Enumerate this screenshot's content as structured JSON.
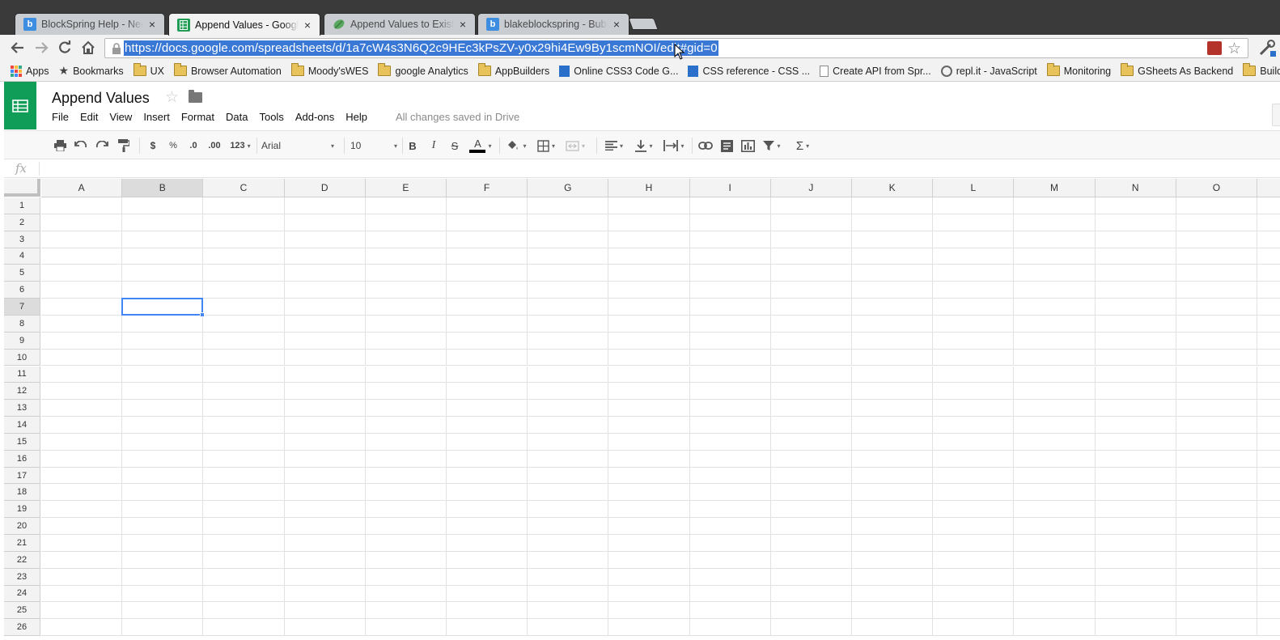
{
  "browser": {
    "tabs": [
      {
        "title": "BlockSpring Help - Need h",
        "favicon": "blockspring-icon",
        "active": false
      },
      {
        "title": "Append Values - Google S",
        "favicon": "google-sheets-icon",
        "active": true
      },
      {
        "title": "Append Values to Existing",
        "favicon": "leaf-icon",
        "active": false
      },
      {
        "title": "blakeblockspring - Bubble",
        "favicon": "blockspring-icon",
        "active": false
      }
    ],
    "close_glyph": "×",
    "url": "https://docs.google.com/spreadsheets/d/1a7cW4s3N6Q2c9HEc3kPsZV-y0x29hi4Ew9By1scmNOI/edit#gid=0",
    "bookmarks": [
      {
        "label": "Apps",
        "icon": "apps-grid-icon"
      },
      {
        "label": "Bookmarks",
        "icon": "star-icon"
      },
      {
        "label": "UX",
        "icon": "folder-icon"
      },
      {
        "label": "Browser Automation",
        "icon": "folder-icon"
      },
      {
        "label": "Moody'sWES",
        "icon": "folder-icon"
      },
      {
        "label": "google Analytics",
        "icon": "folder-icon"
      },
      {
        "label": "AppBuilders",
        "icon": "folder-icon"
      },
      {
        "label": "Online CSS3 Code G...",
        "icon": "css3-icon"
      },
      {
        "label": "CSS reference - CSS ...",
        "icon": "css-reference-icon"
      },
      {
        "label": "Create API from Spr...",
        "icon": "page-icon"
      },
      {
        "label": "repl.it - JavaScript",
        "icon": "repl-icon"
      },
      {
        "label": "Monitoring",
        "icon": "folder-icon"
      },
      {
        "label": "GSheets As Backend",
        "icon": "folder-icon"
      },
      {
        "label": "Build Web App",
        "icon": "folder-icon"
      }
    ]
  },
  "sheets": {
    "doc_title": "Append Values",
    "menu": [
      "File",
      "Edit",
      "View",
      "Insert",
      "Format",
      "Data",
      "Tools",
      "Add-ons",
      "Help"
    ],
    "save_status": "All changes saved in Drive",
    "toolbar": {
      "currency": "$",
      "percent": "%",
      "decrease_decimal": ".0",
      "increase_decimal": ".00",
      "more_formats": "123",
      "font": "Arial",
      "font_size": "10",
      "bold": "B",
      "italic": "I",
      "strike": "S",
      "text_color": "A",
      "sum": "Σ"
    },
    "formula_label": "fx",
    "columns": [
      "A",
      "B",
      "C",
      "D",
      "E",
      "F",
      "G",
      "H",
      "I",
      "J",
      "K",
      "L",
      "M",
      "N",
      "O"
    ],
    "rows": [
      "1",
      "2",
      "3",
      "4",
      "5",
      "6",
      "7",
      "8",
      "9",
      "10",
      "11",
      "12",
      "13",
      "14",
      "15",
      "16",
      "17",
      "18",
      "19",
      "20",
      "21",
      "22",
      "23",
      "24",
      "25",
      "26"
    ],
    "selected_cell": {
      "column": "B",
      "row": "7"
    },
    "colors": {
      "accent": "#4285f4",
      "sheets_green": "#0f9d58",
      "selection_highlight": "#3a78d6"
    }
  }
}
